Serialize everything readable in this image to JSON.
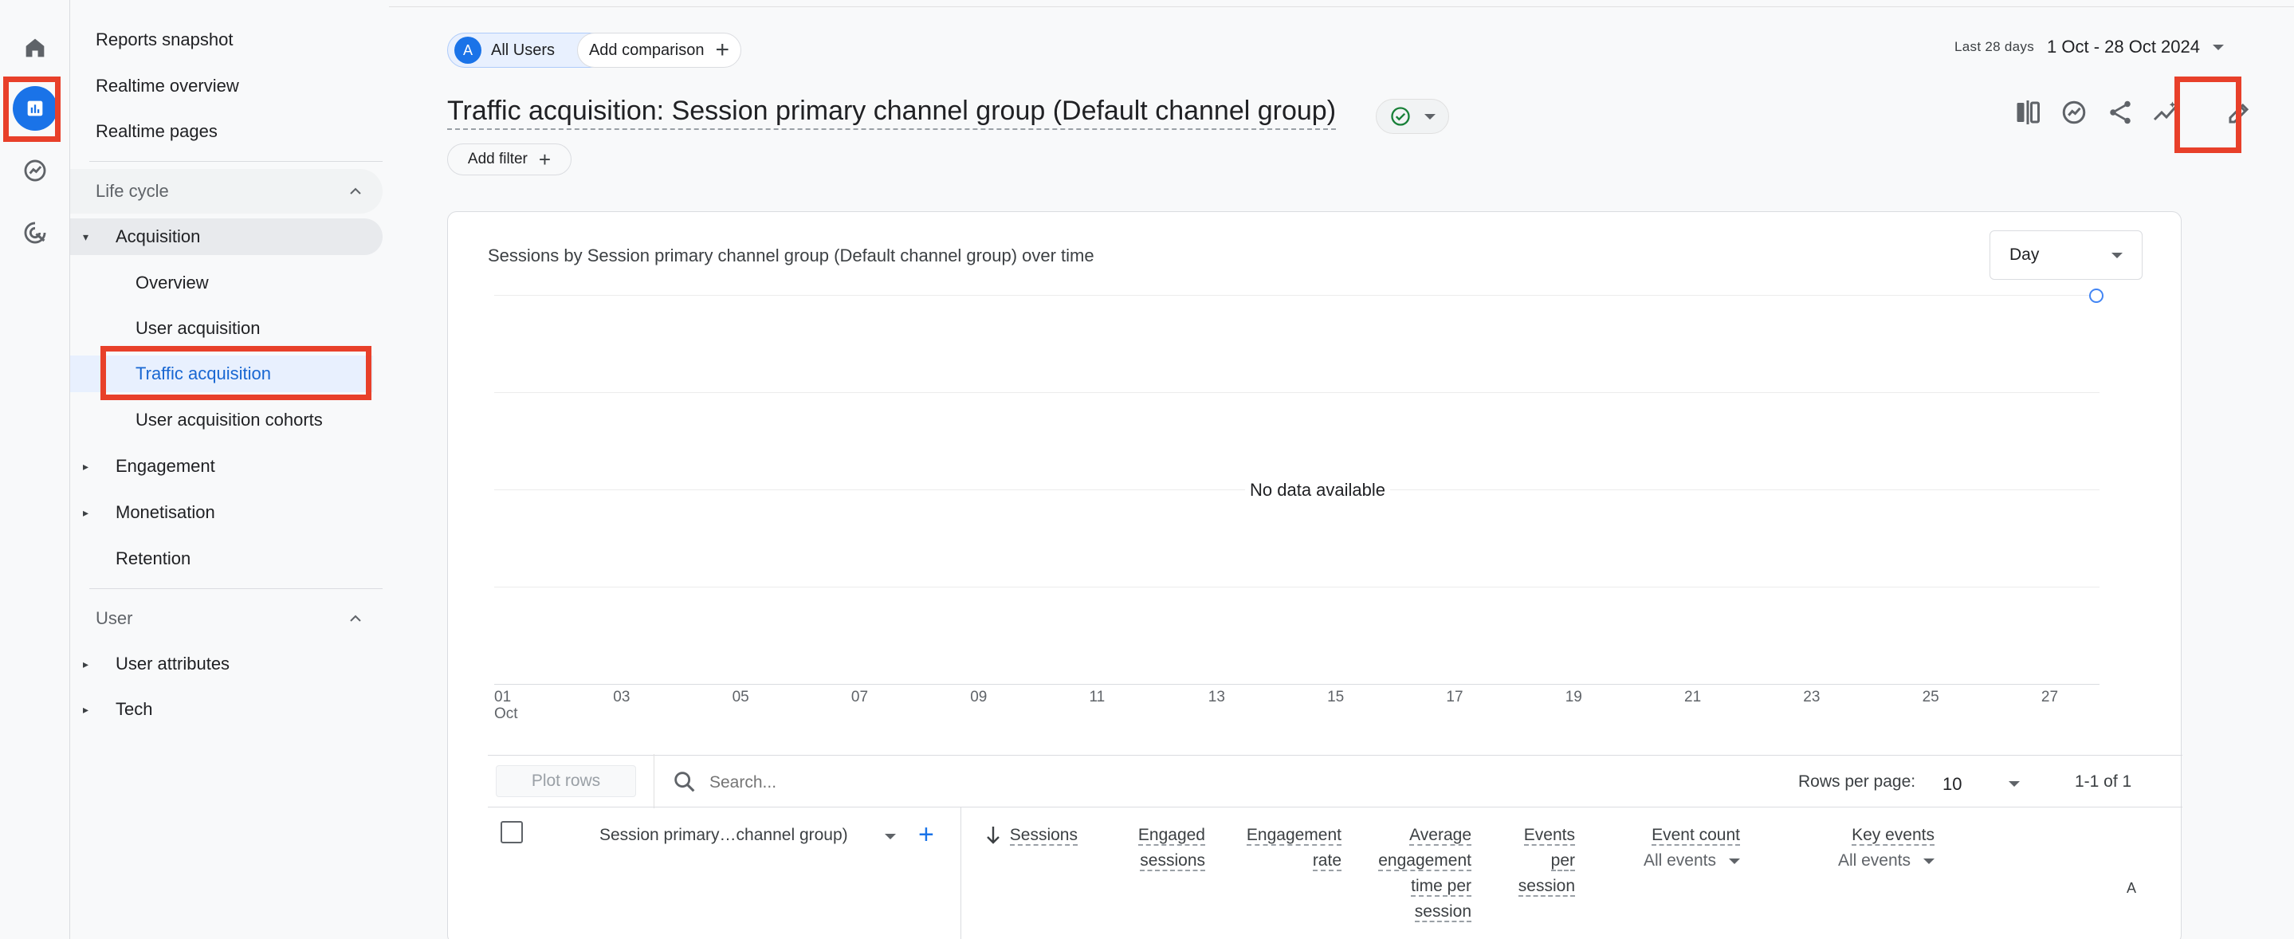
{
  "nav": {
    "top_items": [
      "Reports snapshot",
      "Realtime overview",
      "Realtime pages"
    ],
    "lifecycle_label": "Life cycle",
    "acquisition_label": "Acquisition",
    "acquisition_children": [
      "Overview",
      "User acquisition",
      "Traffic acquisition",
      "User acquisition cohorts"
    ],
    "engagement_label": "Engagement",
    "monetisation_label": "Monetisation",
    "retention_label": "Retention",
    "user_label": "User",
    "user_attributes_label": "User attributes",
    "tech_label": "Tech",
    "selected": "Traffic acquisition"
  },
  "header": {
    "segment_avatar": "A",
    "segment_label": "All Users",
    "add_comparison_label": "Add comparison",
    "date_label": "Last 28 days",
    "date_value": "1 Oct - 28 Oct 2024",
    "title": "Traffic acquisition: Session primary channel group (Default channel group)",
    "add_filter_label": "Add filter"
  },
  "chart": {
    "title": "Sessions by Session primary channel group (Default channel group) over time",
    "granularity": "Day",
    "no_data": "No data available",
    "x_ticks": [
      "01",
      "03",
      "05",
      "07",
      "09",
      "11",
      "13",
      "15",
      "17",
      "19",
      "21",
      "23",
      "25",
      "27"
    ],
    "x_month": "Oct"
  },
  "chart_data": {
    "type": "line",
    "title": "Sessions by Session primary channel group (Default channel group) over time",
    "x": [
      "01 Oct",
      "03",
      "05",
      "07",
      "09",
      "11",
      "13",
      "15",
      "17",
      "19",
      "21",
      "23",
      "25",
      "27"
    ],
    "series": [],
    "annotation": "No data available",
    "grid": true
  },
  "table": {
    "plot_rows_label": "Plot rows",
    "search_placeholder": "Search...",
    "rows_per_page_label": "Rows per page:",
    "rows_per_page_value": "10",
    "page_info": "1-1 of 1",
    "dimension_header": "Session primary…channel group)",
    "columns": [
      {
        "lines": [
          "Sessions"
        ]
      },
      {
        "lines": [
          "Engaged",
          "sessions"
        ]
      },
      {
        "lines": [
          "Engagement",
          "rate"
        ]
      },
      {
        "lines": [
          "Average",
          "engagement",
          "time per",
          "session"
        ]
      },
      {
        "lines": [
          "Events",
          "per",
          "session"
        ]
      },
      {
        "lines": [
          "Event count"
        ],
        "sub": "All events"
      },
      {
        "lines": [
          "Key events"
        ],
        "sub": "All events"
      }
    ],
    "truncated_col": "A"
  },
  "colors": {
    "accent": "#1a73e8",
    "highlight_box": "#e8402a",
    "selected_bg": "#e8f0fe",
    "success": "#188038"
  },
  "icons": [
    "home-icon",
    "reports-icon",
    "explore-icon",
    "advertising-icon",
    "compare-icon",
    "insights-icon",
    "share-icon",
    "trend-icon",
    "pencil-icon",
    "check-circle-icon",
    "search-icon",
    "sort-down-icon"
  ]
}
